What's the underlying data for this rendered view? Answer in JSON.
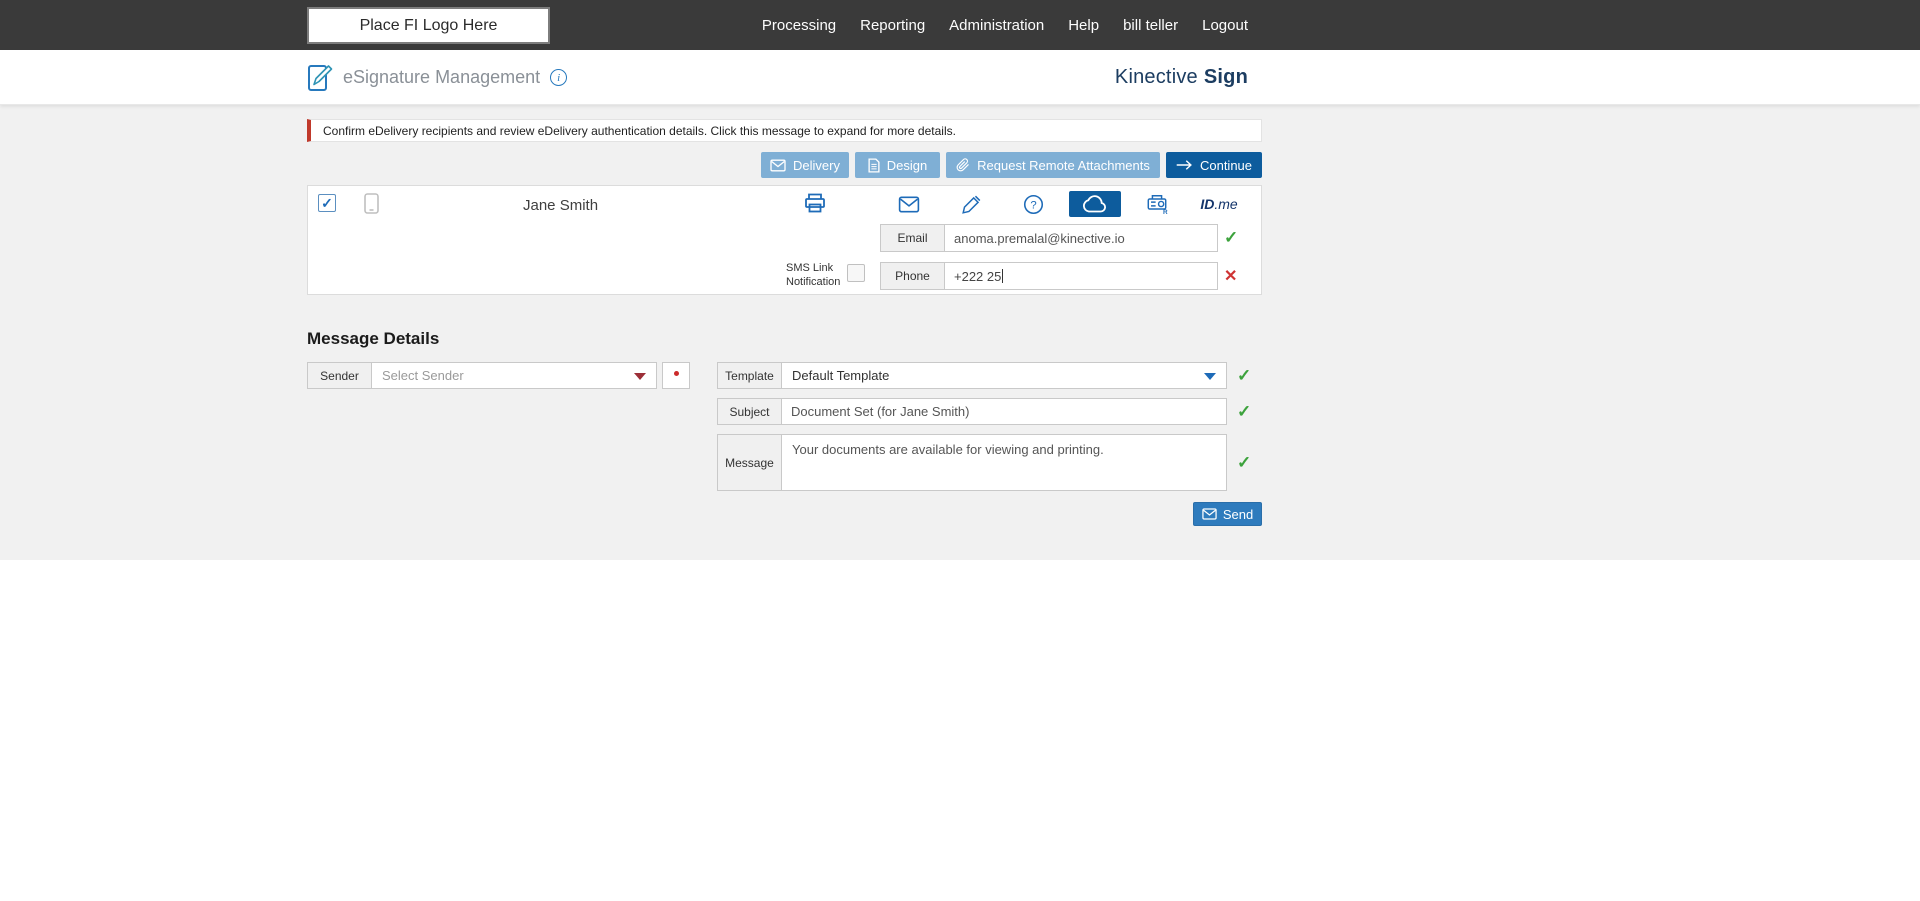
{
  "topbar": {
    "logo_text": "Place FI Logo Here",
    "nav": [
      {
        "label": "Processing"
      },
      {
        "label": "Reporting"
      },
      {
        "label": "Administration"
      },
      {
        "label": "Help"
      },
      {
        "label": "bill teller"
      },
      {
        "label": "Logout"
      }
    ]
  },
  "header": {
    "title": "eSignature Management",
    "brand": {
      "regular": "Kinective",
      "bold": "Sign"
    }
  },
  "alert": {
    "text": "Confirm eDelivery recipients and review eDelivery authentication details. Click this message to expand for more details."
  },
  "toolbar": {
    "delivery": "Delivery",
    "design": "Design",
    "request_remote_attachments": "Request Remote Attachments",
    "continue": "Continue"
  },
  "recipient": {
    "name": "Jane Smith",
    "email": {
      "label": "Email",
      "value": "anoma.premalal@kinective.io"
    },
    "sms_link_notification_label": "SMS Link Notification",
    "phone": {
      "label": "Phone",
      "value": "+222 25"
    },
    "idme": {
      "id": "ID",
      "me": ".me"
    }
  },
  "message_details": {
    "heading": "Message Details",
    "sender": {
      "label": "Sender",
      "placeholder": "Select Sender"
    },
    "template": {
      "label": "Template",
      "value": "Default Template"
    },
    "subject": {
      "label": "Subject",
      "value": "Document Set (for Jane Smith)"
    },
    "message": {
      "label": "Message",
      "value": "Your documents are available for viewing and printing."
    },
    "send": "Send"
  },
  "icons": {
    "info": "i",
    "valid_check": "✓",
    "invalid_cross": "✕",
    "checkbox_check": "✓"
  },
  "colors": {
    "topbar_bg": "#3a3a3a",
    "brand_navy": "#1c3d61",
    "accent_blue": "#1e6bb8",
    "dark_blue_button": "#0d5c9d",
    "light_blue_button": "#7fafd5",
    "send_blue": "#2e7bbd",
    "alert_red": "#c0392b",
    "valid_green": "#3ca23c",
    "invalid_red": "#cf3333",
    "content_bg": "#f1f1f1"
  }
}
